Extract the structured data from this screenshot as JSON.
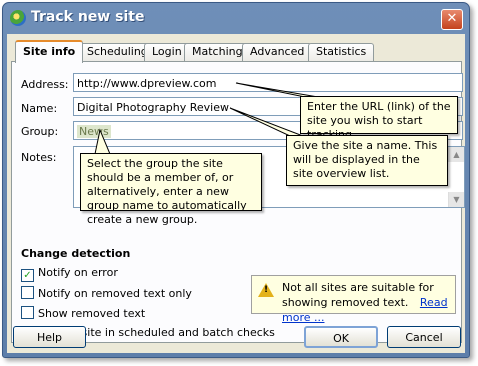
{
  "window": {
    "title": "Track new site",
    "close_symbol": "✕"
  },
  "tabs": [
    "Site info",
    "Scheduling",
    "Login",
    "Matching",
    "Advanced",
    "Statistics"
  ],
  "form": {
    "address_label": "Address:",
    "address_value": "http://www.dpreview.com",
    "name_label": "Name:",
    "name_value": "Digital Photography Review",
    "group_label": "Group:",
    "group_value": "News",
    "notes_label": "Notes:"
  },
  "tooltips": {
    "address": "Enter the URL (link) of the site you wish to start tracking.",
    "name": "Give the site a name. This will be displayed in the site overview list.",
    "group": "Select the group the site should be a member of, or alternatively, enter a new group name to automatically create a new group."
  },
  "change_detection": {
    "heading": "Change detection",
    "options": [
      {
        "label": "Notify on error",
        "checked": true
      },
      {
        "label": "Notify on removed text only",
        "checked": false
      },
      {
        "label": "Show removed text",
        "checked": false
      },
      {
        "label": "Include site in scheduled and batch checks",
        "checked": true
      }
    ]
  },
  "warning": {
    "text": "Not all sites are suitable for showing removed text.",
    "link": "Read more ..."
  },
  "buttons": {
    "help": "Help",
    "ok": "OK",
    "cancel": "Cancel"
  },
  "colors": {
    "title_bar": "#6f8fb8",
    "dialog_bg": "#ece9d8",
    "tooltip_bg": "#ffffe1",
    "active_tab_accent": "#e68b2c"
  }
}
